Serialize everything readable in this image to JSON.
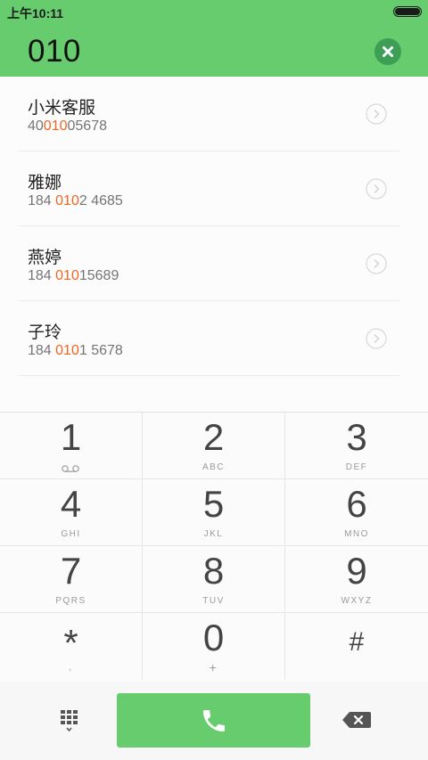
{
  "status_bar": {
    "time": "上午10:11"
  },
  "search": {
    "query": "010",
    "clear_icon": "close-icon"
  },
  "contacts": [
    {
      "name": "小米客服",
      "number_before": "40",
      "number_match": "010",
      "number_after": "05678"
    },
    {
      "name": "雅娜",
      "number_before": "184 ",
      "number_match": "010",
      "number_after": "2 4685"
    },
    {
      "name": "燕婷",
      "number_before": "184 ",
      "number_match": "010",
      "number_after": "15689"
    },
    {
      "name": "子玲",
      "number_before": "184 ",
      "number_match": "010",
      "number_after": "1 5678"
    }
  ],
  "keypad": [
    {
      "digit": "1",
      "letters": ""
    },
    {
      "digit": "2",
      "letters": "ABC"
    },
    {
      "digit": "3",
      "letters": "DEF"
    },
    {
      "digit": "4",
      "letters": "GHI"
    },
    {
      "digit": "5",
      "letters": "JKL"
    },
    {
      "digit": "6",
      "letters": "MNO"
    },
    {
      "digit": "7",
      "letters": "PQRS"
    },
    {
      "digit": "8",
      "letters": "TUV"
    },
    {
      "digit": "9",
      "letters": "WXYZ"
    },
    {
      "digit": "*",
      "letters": ","
    },
    {
      "digit": "0",
      "letters": "+"
    },
    {
      "digit": "#",
      "letters": ""
    }
  ],
  "icons": {
    "voicemail": "voicemail-icon",
    "dialpad": "dialpad-icon",
    "call": "phone-icon",
    "delete": "backspace-icon",
    "chevron": "chevron-right-icon"
  },
  "colors": {
    "accent": "#66cc6e",
    "highlight": "#f26622",
    "clear_button": "#3f9e55"
  }
}
